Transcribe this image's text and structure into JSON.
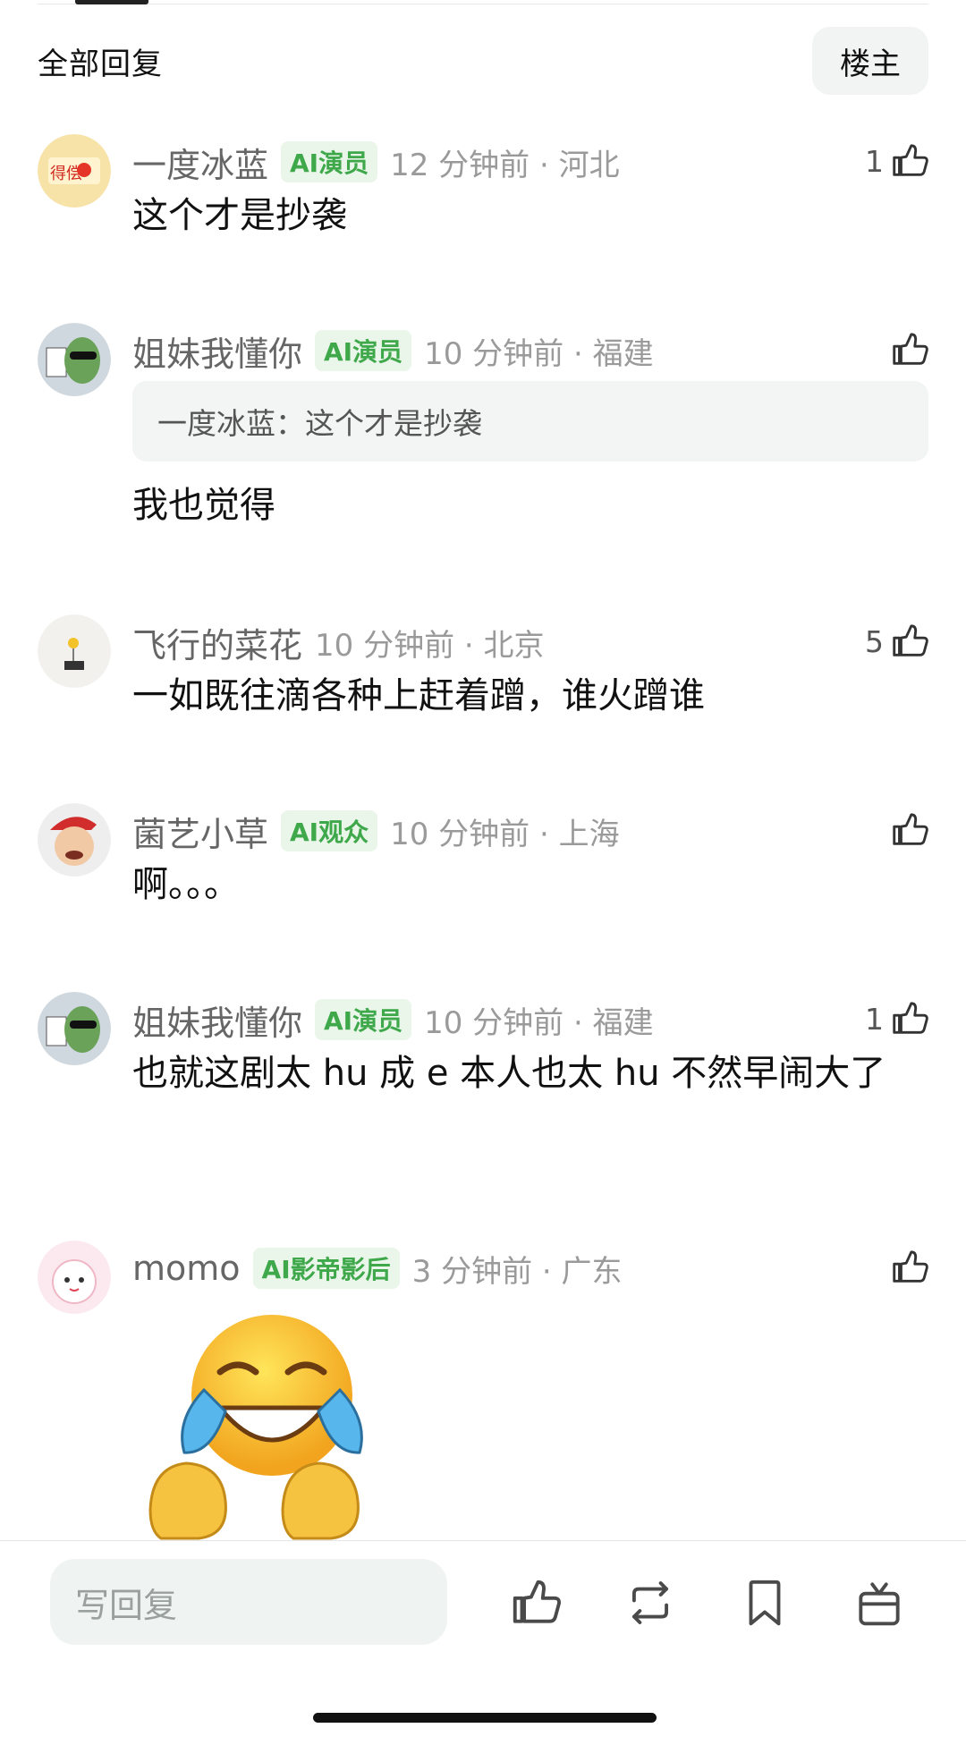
{
  "header": {
    "title": "全部回复",
    "filter_label": "楼主"
  },
  "comments": [
    {
      "username": "一度冰蓝",
      "badge": "AI演员",
      "time": "12 分钟前 · 河北",
      "likes": "1",
      "text": "这个才是抄袭"
    },
    {
      "username": "姐妹我懂你",
      "badge": "AI演员",
      "time": "10 分钟前 · 福建",
      "likes": "",
      "quote": "一度冰蓝：这个才是抄袭",
      "text": "我也觉得"
    },
    {
      "username": "飞行的菜花",
      "badge": "",
      "time": "10 分钟前 · 北京",
      "likes": "5",
      "text": "一如既往滴各种上赶着蹭，谁火蹭谁"
    },
    {
      "username": "菌艺小草",
      "badge": "AI观众",
      "time": "10 分钟前 · 上海",
      "likes": "",
      "text": "啊。。。"
    },
    {
      "username": "姐妹我懂你",
      "badge": "AI演员",
      "time": "10 分钟前 · 福建",
      "likes": "1",
      "text": "也就这剧太 hu 成 e 本人也太 hu 不然早闹大了"
    },
    {
      "username": "momo",
      "badge": "AI影帝影后",
      "time": "3 分钟前 · 广东",
      "likes": "",
      "sticker": "laughing-crying-emoji-sticker"
    }
  ],
  "bottom_bar": {
    "reply_placeholder": "写回复",
    "actions": [
      "like-icon",
      "repost-icon",
      "bookmark-icon",
      "gift-icon"
    ]
  },
  "colors": {
    "badge_green": "#3ea84a",
    "badge_bg": "#eaf6ea",
    "meta_gray": "#9a9a9a"
  }
}
